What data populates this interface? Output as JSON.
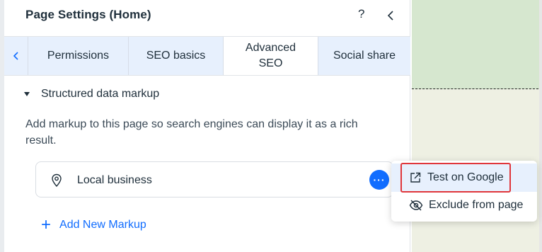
{
  "panel": {
    "title": "Page Settings (Home)",
    "help_label": "?",
    "tabs": [
      "Permissions",
      "SEO basics",
      "Advanced SEO",
      "Social share"
    ],
    "active_tab": "Advanced SEO",
    "section": {
      "label": "Structured data markup",
      "expanded": true
    },
    "description": "Add markup to this page so search engines can display it as a rich result.",
    "markup_items": [
      {
        "label": "Local business",
        "icon": "location-pin-icon"
      }
    ],
    "more_label": "···",
    "add_new_label": "Add New Markup"
  },
  "context_menu": {
    "items": [
      {
        "label": "Test on Google",
        "icon": "external-link-icon",
        "highlighted": true
      },
      {
        "label": "Exclude from page",
        "icon": "eye-off-icon",
        "highlighted": false
      }
    ]
  },
  "colors": {
    "accent": "#116dff",
    "highlight_border": "#e0363b",
    "tab_bg": "#e7f0fd"
  }
}
